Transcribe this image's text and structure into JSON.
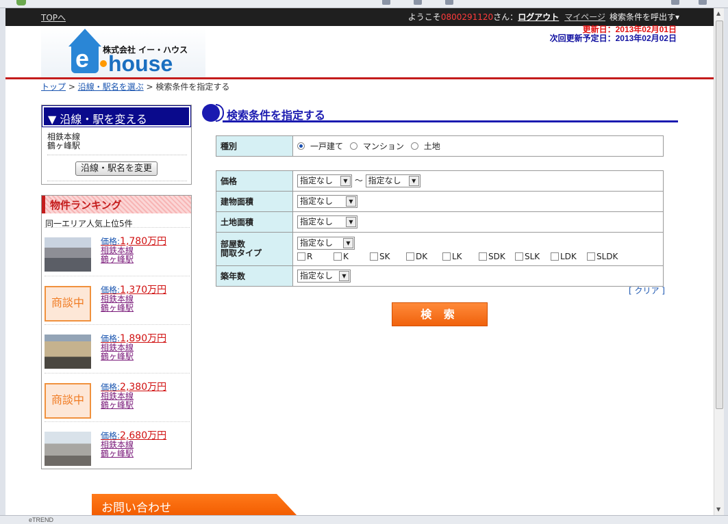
{
  "header": {
    "top_link": "TOPへ",
    "welcome_prefix": "ようこそ",
    "user_id": "0800291120",
    "welcome_suffix": "さん：",
    "logout": "ログアウト",
    "mypage": "マイページ",
    "call_conditions": "検索条件を呼出す▾",
    "update_date": "更新日：2013年02月01日",
    "next_update": "次回更新予定日：2013年02月02日",
    "logo_company": "株式会社 イー・ハウス",
    "logo_e": "e",
    "logo_house": "house"
  },
  "breadcrumb": {
    "top": "トップ",
    "sep1": " > ",
    "line_select": "沿線・駅名を選ぶ",
    "sep2": " > ",
    "current": "検索条件を指定する"
  },
  "sidebar": {
    "line_box_title": "▼ 沿線・駅を変える",
    "line_name": "相鉄本線",
    "station_name": "鶴ヶ峰駅",
    "change_button": "沿線・駅名を変更",
    "ranking_title": "物件ランキング",
    "ranking_sub": "同一エリア人気上位5件",
    "ranking_items": [
      {
        "price_label": "価格:",
        "price": "1,780万円",
        "line": "相鉄本線",
        "station": "鶴ヶ峰駅",
        "photo": "house-photo"
      },
      {
        "price_label": "価格:",
        "price": "1,370万円",
        "line": "相鉄本線",
        "station": "鶴ヶ峰駅",
        "badge": "商談中"
      },
      {
        "price_label": "価格:",
        "price": "1,890万円",
        "line": "相鉄本線",
        "station": "鶴ヶ峰駅",
        "photo": "house-photo"
      },
      {
        "price_label": "価格:",
        "price": "2,380万円",
        "line": "相鉄本線",
        "station": "鶴ヶ峰駅",
        "badge": "商談中"
      },
      {
        "price_label": "価格:",
        "price": "2,680万円",
        "line": "相鉄本線",
        "station": "鶴ヶ峰駅",
        "photo": "house-photo"
      }
    ],
    "contact": "お問い合わせ"
  },
  "main": {
    "title": "検索条件を指定する",
    "type_label": "種別",
    "type_options": [
      "一戸建て",
      "マンション",
      "土地"
    ],
    "type_selected": "一戸建て",
    "price_label": "価格",
    "price_min": "指定なし",
    "price_tilde": "～",
    "price_max": "指定なし",
    "building_area_label": "建物面積",
    "building_area": "指定なし",
    "land_area_label": "土地面積",
    "land_area": "指定なし",
    "rooms_label": "部屋数",
    "layout_label": "間取タイプ",
    "rooms": "指定なし",
    "layout_types": [
      "R",
      "K",
      "SK",
      "DK",
      "LK",
      "SDK",
      "SLK",
      "LDK",
      "SLDK"
    ],
    "age_label": "築年数",
    "age": "指定なし",
    "clear": "[ クリア ]",
    "search_button": "検 索"
  },
  "status_bar": {
    "text": "eTREND"
  },
  "colors": {
    "accent_red": "#c41c1c",
    "nav_blue": "#0a0a8c",
    "orange": "#f0620c",
    "table_label_bg": "#d6f0f4"
  }
}
